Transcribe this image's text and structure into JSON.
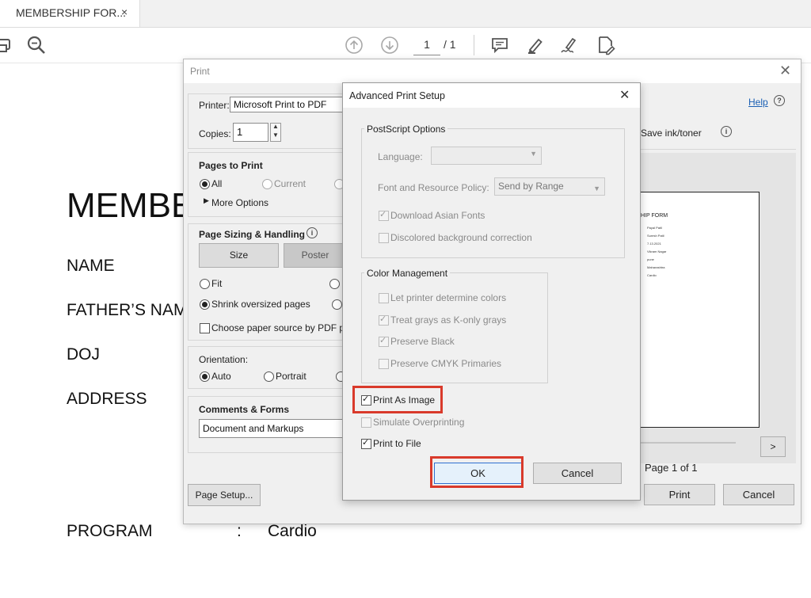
{
  "tab": {
    "title": "MEMBERSHIP FOR...",
    "close": "×"
  },
  "toolbar": {
    "icons": [
      "print-icon",
      "zoom-icon",
      "page-up-icon",
      "page-down-icon",
      "comment-icon",
      "highlight-icon",
      "sign-icon",
      "edit-document-icon"
    ],
    "current_page": "1",
    "total_pages": "/ 1"
  },
  "document": {
    "title_partial": "MEMBE",
    "fields": [
      "NAME",
      "FATHER’S NAM",
      "DOJ",
      "ADDRESS"
    ],
    "program_label": "PROGRAM",
    "program_sep": ":",
    "program_value": "Cardio"
  },
  "print_dialog": {
    "title": "Print",
    "help_link": "Help",
    "printer_label": "Printer:",
    "printer_value": "Microsoft Print to PDF",
    "copies_label": "Copies:",
    "copies_value": "1",
    "save_ink": "Save ink/toner",
    "pages_to_print": "Pages to Print",
    "all": "All",
    "current": "Current",
    "more_options": "More Options",
    "page_sizing": "Page Sizing & Handling",
    "size_btn": "Size",
    "poster_btn": "Poster",
    "fit": "Fit",
    "shrink": "Shrink oversized pages",
    "choose_paper": "Choose paper source by PDF pa",
    "orientation": "Orientation:",
    "auto": "Auto",
    "portrait": "Portrait",
    "comments_forms": "Comments & Forms",
    "comments_value": "Document and Markups",
    "page_setup": "Page Setup...",
    "next_btn": ">",
    "page_of": "Page 1 of 1",
    "print_btn": "Print",
    "cancel_btn": "Cancel",
    "preview": {
      "heading": "HIP FORM",
      "lines": [
        "Payal Patil",
        "Suresh Patil",
        "7.13.2021",
        "Vikram Nagar",
        "pune",
        "Maharashtra",
        "Cardio"
      ]
    }
  },
  "advanced_dialog": {
    "title": "Advanced Print Setup",
    "close": "✕",
    "postscript_group": "PostScript Options",
    "language_label": "Language:",
    "font_policy_label": "Font and Resource Policy:",
    "font_policy_value": "Send by Range",
    "download_asian": "Download Asian Fonts",
    "discolored_bg": "Discolored background correction",
    "color_group": "Color Management",
    "let_printer": "Let printer determine colors",
    "treat_grays": "Treat grays as K-only grays",
    "preserve_black": "Preserve Black",
    "preserve_cmyk": "Preserve CMYK Primaries",
    "print_as_image": "Print As Image",
    "simulate_overprinting": "Simulate Overprinting",
    "print_to_file": "Print to File",
    "ok_btn": "OK",
    "cancel_btn": "Cancel"
  },
  "colors": {
    "highlight": "#d93a2b",
    "link": "#1a5fb4",
    "ok_border": "#2f6fd0"
  }
}
